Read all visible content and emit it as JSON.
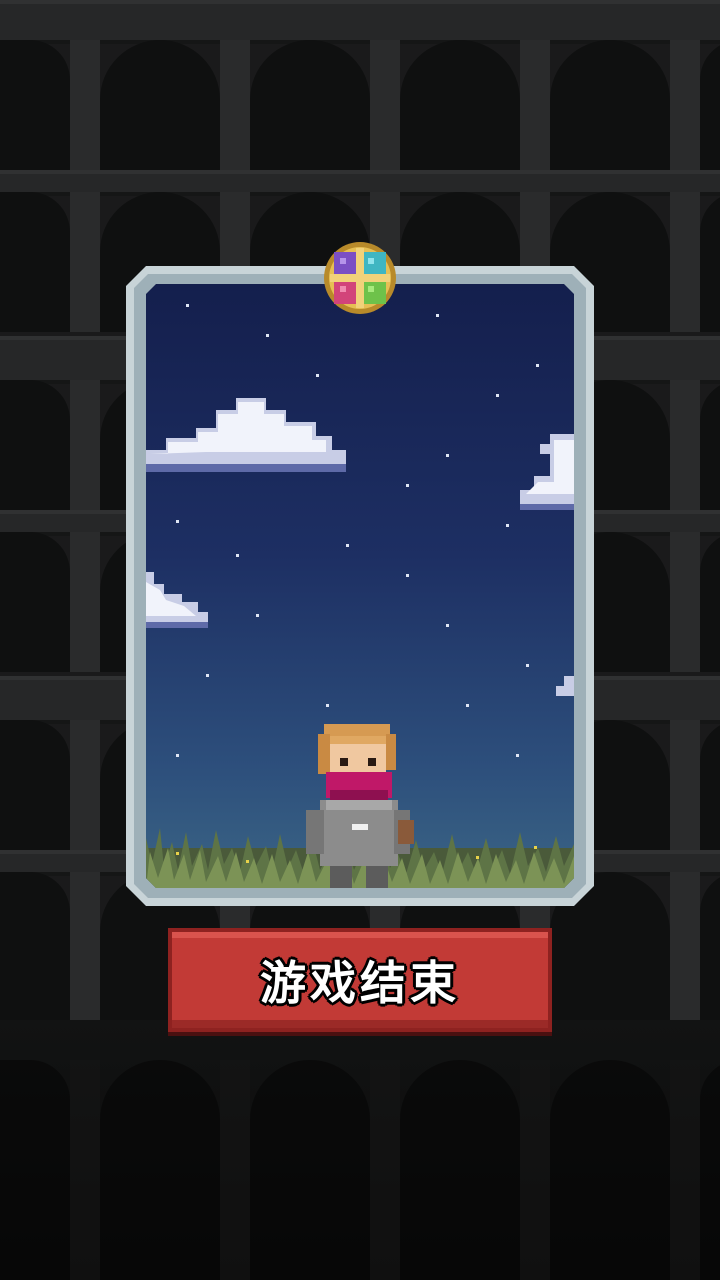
{
  "screen": "game-over",
  "button": {
    "label": "游戏结束"
  },
  "colors": {
    "button_red": "#c23a36",
    "card_frame": "#c8d4d8",
    "sky_top": "#141f4d",
    "sky_bottom": "#3b6585",
    "emblem_gold": "#d4a53a",
    "background": "#1a1a1b"
  },
  "icons": {
    "emblem": "four-gem-emblem-icon",
    "hero": "masked-character-sprite"
  }
}
